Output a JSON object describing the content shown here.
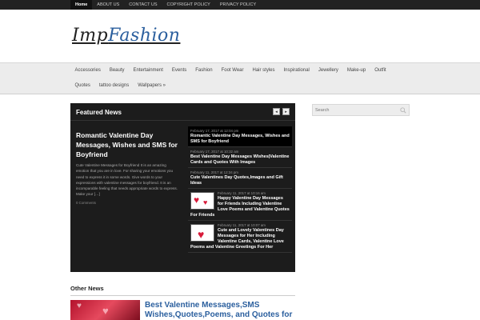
{
  "topnav": [
    "Home",
    "ABOUT US",
    "CONTACT US",
    "COPYRIGHT POLICY",
    "PRIVACY POLICY"
  ],
  "logo": {
    "part1": "Imp",
    "part2": "Fashion"
  },
  "mainnav": [
    "Accessories",
    "Beauty",
    "Entertainment",
    "Events",
    "Fashion",
    "Foot Wear",
    "Hair styles",
    "Inspirational",
    "Jewellery",
    "Make-up",
    "Outfit",
    "Quotes",
    "tattoo designs",
    "Wallpapers »"
  ],
  "featured": {
    "heading": "Featured News",
    "prev": "◂",
    "next": "▸",
    "main_title": "Romantic Valentine Day Messages, Wishes and SMS for Boyfriend",
    "main_excerpt": "Cute Valentine Messages for Boyfriend It is an amazing emotion that you are in love. For sharing your emotions you need to express it in some words. Give words to your expressions with valentine messages for boyfriend. It is an incomparable feeling that needs appropriate words to express. Make your […]",
    "main_comments": "0 Comments",
    "stories": [
      {
        "date": "February 17, 2017 at 12:04 pm",
        "title": "Romantic Valentine Day Messages, Wishes and SMS for Boyfriend",
        "thumb": false
      },
      {
        "date": "February 17, 2017 at 10:32 am",
        "title": "Best Valentine Day Messages Wishes|Valentine Cards and Quotes With Images",
        "thumb": false
      },
      {
        "date": "February 11, 2017 at 12:34 pm",
        "title": "Cute Valentines Day Quotes,Images and Gift Ideas",
        "thumb": false
      },
      {
        "date": "February 11, 2017 at 10:16 am",
        "title": "Happy Valentine Day Messages for Friends Including Valentine Love Poems and Valentine Quotes For Friends",
        "thumb": true
      },
      {
        "date": "February 11, 2017 at 10:07 am",
        "title": "Cute and Lovely Valentines Day Messages for Her Including Valentine Cards, Valentine Love Poems and Valentine Greetings For Her",
        "thumb": true
      }
    ]
  },
  "other_news": {
    "heading": "Other News",
    "title": "Best Valentine Messages,SMS Wishes,Quotes,Poems, and Quotes for"
  },
  "search": {
    "placeholder": "Search"
  }
}
